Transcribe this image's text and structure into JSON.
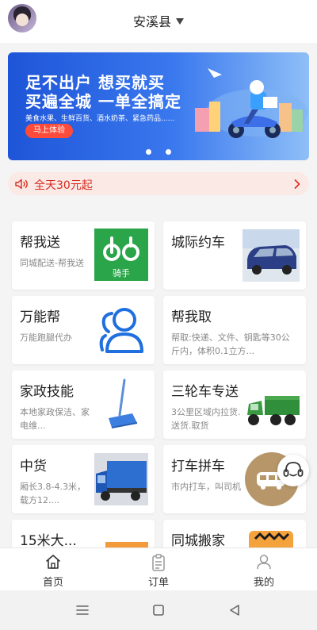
{
  "header": {
    "city": "安溪县"
  },
  "banner": {
    "line1": "足不出户 想买就买",
    "line2": "买遍全城 一单全搞定",
    "sub": "美食水果、生鲜百货、酒水奶茶、紧急药品......",
    "cta": "马上体验"
  },
  "notice": {
    "text": "全天30元起"
  },
  "services": [
    {
      "title": "帮我送",
      "desc": "同城配送-帮我送",
      "image_text": "骑手"
    },
    {
      "title": "城际约车",
      "desc": ""
    },
    {
      "title": "万能帮",
      "desc": "万能跑腿代办"
    },
    {
      "title": "帮我取",
      "desc": "帮取:快递、文件、钥匙等30公斤内，体积0.1立方..."
    },
    {
      "title": "家政技能",
      "desc": "本地家政保洁、家电维..."
    },
    {
      "title": "三轮车专送",
      "desc": "3公里区域内拉货.送货.取货"
    },
    {
      "title": "中货",
      "desc": "厢长3.8-4.3米， 载方12...."
    },
    {
      "title": "打车拼车",
      "desc": "市内打车，叫司机"
    },
    {
      "title": "15米大...",
      "desc": ""
    },
    {
      "title": "同城搬家",
      "desc": ""
    }
  ],
  "tabbar": {
    "home": "首页",
    "orders": "订单",
    "mine": "我的"
  },
  "colors": {
    "accent_red": "#d72b1e",
    "notice_bg": "#fbe9e6",
    "banner_blue": "#2a63e0",
    "rider_green": "#2aa54a"
  },
  "icons": {
    "notice": "speaker-icon",
    "home": "home-icon",
    "orders": "clipboard-icon",
    "mine": "person-icon",
    "service": "headset-icon"
  }
}
